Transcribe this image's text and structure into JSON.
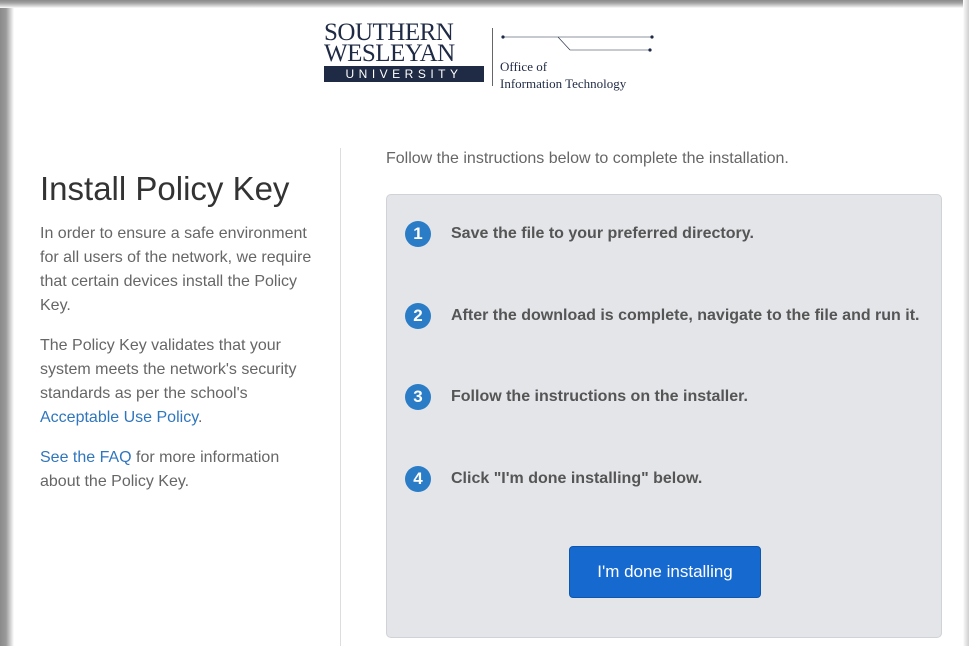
{
  "logo": {
    "line1": "SOUTHERN",
    "line2": "WESLEYAN",
    "bar": "UNIVERSITY",
    "office_line1": "Office of",
    "office_line2": "Information Technology",
    "color": "#1f2a44"
  },
  "sidebar": {
    "title": "Install Policy Key",
    "para1": "In order to ensure a safe environment for all users of the network, we require that certain devices install the Policy Key.",
    "para2_prefix": "The Policy Key validates that your system meets the network's security standards as per the school's ",
    "para2_link": "Acceptable Use Policy",
    "para2_suffix": ".",
    "para3_link": "See the FAQ",
    "para3_suffix": " for more information about the Policy Key."
  },
  "main": {
    "intro": "Follow the instructions below to complete the installation.",
    "steps": [
      {
        "num": "1",
        "text": "Save the file to your preferred directory."
      },
      {
        "num": "2",
        "text": "After the download is complete, navigate to the file and run it."
      },
      {
        "num": "3",
        "text": "Follow the instructions on the installer."
      },
      {
        "num": "4",
        "text": "Click \"I'm done installing\" below."
      }
    ],
    "done_button": "I'm done installing"
  },
  "colors": {
    "accent": "#2a7cc7",
    "button": "#1569cf",
    "link": "#2f76bd",
    "panel": "#e3e5e8"
  }
}
